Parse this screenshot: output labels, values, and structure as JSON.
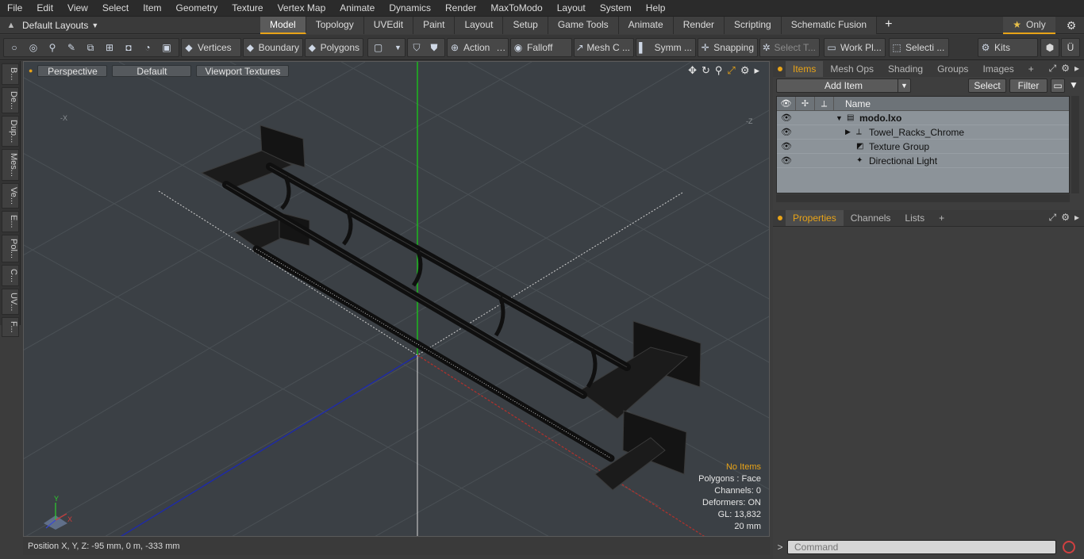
{
  "menu": [
    "File",
    "Edit",
    "View",
    "Select",
    "Item",
    "Geometry",
    "Texture",
    "Vertex Map",
    "Animate",
    "Dynamics",
    "Render",
    "MaxToModo",
    "Layout",
    "System",
    "Help"
  ],
  "layouts": {
    "label": "Default Layouts"
  },
  "tabs": [
    {
      "label": "Model",
      "active": true
    },
    {
      "label": "Topology"
    },
    {
      "label": "UVEdit"
    },
    {
      "label": "Paint"
    },
    {
      "label": "Layout"
    },
    {
      "label": "Setup"
    },
    {
      "label": "Game Tools"
    },
    {
      "label": "Animate"
    },
    {
      "label": "Render"
    },
    {
      "label": "Scripting"
    },
    {
      "label": "Schematic Fusion"
    }
  ],
  "only_label": "Only",
  "toolbar": {
    "vertices": "Vertices",
    "boundary": "Boundary",
    "polygons": "Polygons",
    "action": "Action",
    "falloff": "Falloff",
    "mesh_c": "Mesh C ...",
    "symm": "Symm ...",
    "snapping": "Snapping",
    "select_t": "Select T...",
    "work_pl": "Work Pl...",
    "selecti": "Selecti ...",
    "kits": "Kits"
  },
  "left_tabs": [
    "B...",
    "De...",
    "Dup...",
    "Mes...",
    "Ve...",
    "E...",
    "Pol...",
    "C...",
    "UV...",
    "F..."
  ],
  "viewport": {
    "perspective": "Perspective",
    "default": "Default",
    "viewport_textures": "Viewport Textures",
    "corner_neg_x": "-X",
    "corner_neg_z": "-Z",
    "stats": {
      "no_items": "No Items",
      "polygons": "Polygons : Face",
      "channels": "Channels: 0",
      "deformers": "Deformers: ON",
      "gl": "GL: 13,832",
      "scale": "20 mm"
    }
  },
  "status_bar": "Position X, Y, Z:  -95 mm, 0 m, -333 mm",
  "right_panel": {
    "top_tabs": [
      "Items",
      "Mesh Ops",
      "Shading",
      "Groups",
      "Images"
    ],
    "add_item": "Add Item",
    "select_btn": "Select",
    "filter_btn": "Filter",
    "name_col": "Name",
    "tree": [
      {
        "label": "modo.lxo",
        "bold": true,
        "indent": 1
      },
      {
        "label": "Towel_Racks_Chrome",
        "indent": 2
      },
      {
        "label": "Texture Group",
        "indent": 2
      },
      {
        "label": "Directional Light",
        "indent": 2
      }
    ],
    "prop_tabs": [
      "Properties",
      "Channels",
      "Lists"
    ],
    "command_placeholder": "Command"
  }
}
